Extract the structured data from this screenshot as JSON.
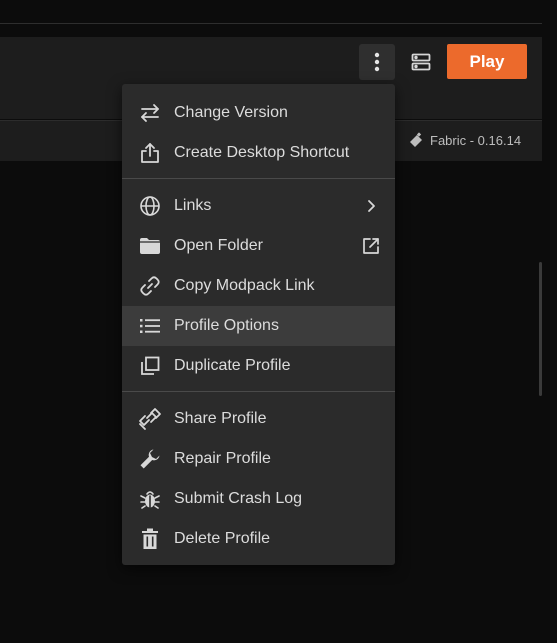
{
  "header": {
    "play_label": "Play",
    "loader_label": "Fabric - 0.16.14"
  },
  "menu": {
    "groups": [
      [
        {
          "label": "Change Version",
          "icon": "swap-arrows-icon"
        },
        {
          "label": "Create Desktop Shortcut",
          "icon": "share-upload-icon"
        }
      ],
      [
        {
          "label": "Links",
          "icon": "globe-icon",
          "trailing": "chevron-right-icon"
        },
        {
          "label": "Open Folder",
          "icon": "folder-icon",
          "trailing": "external-link-icon"
        },
        {
          "label": "Copy Modpack Link",
          "icon": "link-icon"
        },
        {
          "label": "Profile Options",
          "icon": "list-icon",
          "highlighted": true
        },
        {
          "label": "Duplicate Profile",
          "icon": "duplicate-icon"
        }
      ],
      [
        {
          "label": "Share Profile",
          "icon": "share-link-icon"
        },
        {
          "label": "Repair Profile",
          "icon": "wrench-icon"
        },
        {
          "label": "Submit Crash Log",
          "icon": "bug-icon"
        },
        {
          "label": "Delete Profile",
          "icon": "trash-icon"
        }
      ]
    ]
  },
  "colors": {
    "accent": "#ec6a2c",
    "background": "#0c0c0c",
    "panel": "#1d1d1d",
    "menu": "#2b2b2b",
    "highlight": "#3c3c3c"
  }
}
